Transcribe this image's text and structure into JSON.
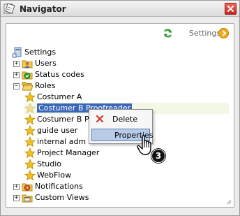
{
  "window": {
    "title": "Navigator"
  },
  "toolbar": {
    "settings_label": "Settings"
  },
  "tree": {
    "root": "Settings",
    "users": "Users",
    "status_codes": "Status codes",
    "roles": "Roles",
    "role_items": [
      "Costumer A",
      "Costumer B Proofreader",
      "Costumer B Pro",
      "guide user",
      "internal adm",
      "Project Manager",
      "Studio",
      "WebFlow"
    ],
    "notifications": "Notifications",
    "custom_views": "Custom Views",
    "expand_symbol": "+",
    "collapse_symbol": "−"
  },
  "context_menu": {
    "delete_label": "Delete",
    "properties_label": "Properties"
  },
  "step_badge": "3",
  "colors": {
    "star": "#f2c21b",
    "folder": "#f3c94a",
    "close": "#d0342a",
    "highlight": "#b8cce8"
  }
}
